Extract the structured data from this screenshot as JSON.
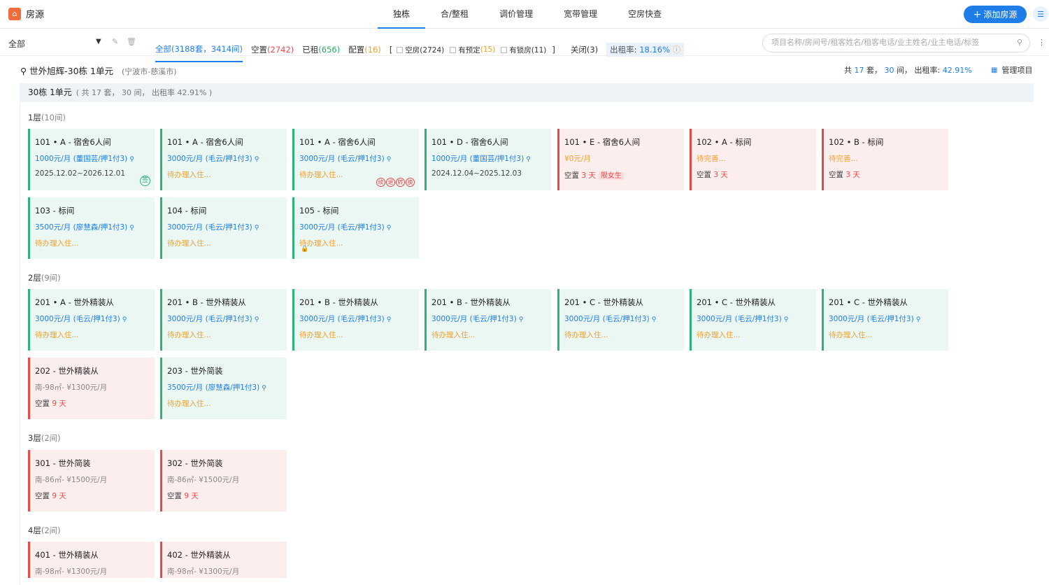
{
  "app": {
    "title": "房源",
    "add_label": "添加房源",
    "add_plus": "+",
    "brand_glyph": "⌂",
    "list_glyph": "☰"
  },
  "tabs": [
    "独栋",
    "合/整租",
    "调价管理",
    "宽带管理",
    "空房快查"
  ],
  "filter": {
    "scope": "全部",
    "all_label": "全部(3188套，3414间)",
    "vacant_label": "空置",
    "vacant_count": "(2742)",
    "rented_label": "已租",
    "rented_count": "(656)",
    "config_label": "配置",
    "config_count": "(16)",
    "bracket_open": "[",
    "bracket_close": "]",
    "empty_label": "空房(2724)",
    "reserved_label": "有预定",
    "reserved_count": "(15)",
    "locked_label": "有锁房(11)",
    "closed_label": "关闭(3)",
    "rate_label": "出租率:",
    "rate_value": "18.16%",
    "search_placeholder": "项目名称/房间号/租客姓名/租客电话/业主姓名/业主电话/标签"
  },
  "project": {
    "name": "世外旭辉-30栋 1单元",
    "region": "(宁波市-慈溪市)",
    "stats_prefix": "共",
    "sets": "17",
    "sets_unit": "套，",
    "rooms": "30",
    "rooms_unit": "间，",
    "rate_label": "出租率:",
    "rate": "42.91%",
    "manage_label": "管理项目"
  },
  "unit": {
    "name": "30栋 1单元",
    "meta": "( 共 17 套， 30 间， 出租率 42.91% )"
  },
  "floors": [
    {
      "name": "1层",
      "count": "(10间)"
    },
    {
      "name": "2层",
      "count": "(9间)"
    },
    {
      "name": "3层",
      "count": "(2间)"
    },
    {
      "name": "4层",
      "count": "(2间)"
    }
  ],
  "rooms": [
    {
      "title": "101 • A - 宿舍6人间",
      "price": "1000元/月 (董国芸/押1付3)",
      "line3": "2025.12.02~2026.12.01",
      "badge": "签"
    },
    {
      "title": "101 • A - 宿舍6人间",
      "price": "3000元/月 (毛云/押1付3)",
      "line3": "待办理入住..."
    },
    {
      "title": "101 • A - 宿舍6人间",
      "price": "3000元/月 (毛云/押1付3)",
      "line3": "待办理入住...",
      "ops": [
        "续",
        "退",
        "转",
        "换"
      ]
    },
    {
      "title": "101 • D - 宿舍6人间",
      "price": "1000元/月 (董国芸/押1付3)",
      "line3": "2024.12.04~2025.12.03"
    },
    {
      "title": "101 • E - 宿舍6人间",
      "price": "¥0元/月",
      "vacant": "空置",
      "days": "3 天",
      "tag": "限女生"
    },
    {
      "title": "102 • A - 标间",
      "price": "待完善...",
      "vacant": "空置",
      "days": "3 天"
    },
    {
      "title": "102 • B - 标间",
      "price": "待完善...",
      "vacant": "空置",
      "days": "3 天"
    },
    {
      "title": "103 - 标间",
      "price": "3500元/月 (廖慧森/押1付3)",
      "line3": "待办理入住..."
    },
    {
      "title": "104 - 标间",
      "price": "3000元/月 (毛云/押1付3)",
      "line3": "待办理入住..."
    },
    {
      "title": "105 - 标间",
      "price": "3000元/月 (毛云/押1付3)",
      "line3": "待办理入住..."
    },
    {
      "title": "201 • A - 世外精装从",
      "price": "3000元/月 (毛云/押1付3)",
      "line3": "待办理入住..."
    },
    {
      "title": "201 • B - 世外精装从",
      "price": "3000元/月 (毛云/押1付3)",
      "line3": "待办理入住..."
    },
    {
      "title": "201 • B - 世外精装从",
      "price": "3000元/月 (毛云/押1付3)",
      "line3": "待办理入住..."
    },
    {
      "title": "201 • B - 世外精装从",
      "price": "3000元/月 (毛云/押1付3)",
      "line3": "待办理入住..."
    },
    {
      "title": "201 • C - 世外精装从",
      "price": "3000元/月 (毛云/押1付3)",
      "line3": "待办理入住..."
    },
    {
      "title": "201 • C - 世外精装从",
      "price": "3000元/月 (毛云/押1付3)",
      "line3": "待办理入住..."
    },
    {
      "title": "201 • C - 世外精装从",
      "price": "3000元/月 (毛云/押1付3)",
      "line3": "待办理入住..."
    },
    {
      "title": "202 - 世外精装从",
      "price": "南-98㎡- ¥1300元/月",
      "vacant": "空置",
      "days": "9 天"
    },
    {
      "title": "203 - 世外简装",
      "price": "3500元/月 (廖慧森/押1付3)",
      "line3": "待办理入住..."
    },
    {
      "title": "301 - 世外简装",
      "price": "南-86㎡- ¥1500元/月",
      "vacant": "空置",
      "days": "9 天"
    },
    {
      "title": "302 - 世外简装",
      "price": "南-86㎡- ¥1500元/月",
      "vacant": "空置",
      "days": "9 天"
    },
    {
      "title": "401 - 世外精装从",
      "price": "南-98㎡- ¥1300元/月"
    },
    {
      "title": "402 - 世外精装从",
      "price": "南-98㎡- ¥1300元/月"
    }
  ],
  "icons": {
    "brand": "home-icon",
    "search": "search-icon",
    "edit": "edit-icon",
    "trash": "trash-icon",
    "info": "info-icon",
    "location": "location-pin-icon",
    "grid": "grid-icon",
    "more": "more-vertical-icon",
    "lock": "lock-icon"
  },
  "colors": {
    "accent": "#1e7de6",
    "green": "#2db37a",
    "red": "#e84a4a",
    "orange": "#f0a030"
  }
}
